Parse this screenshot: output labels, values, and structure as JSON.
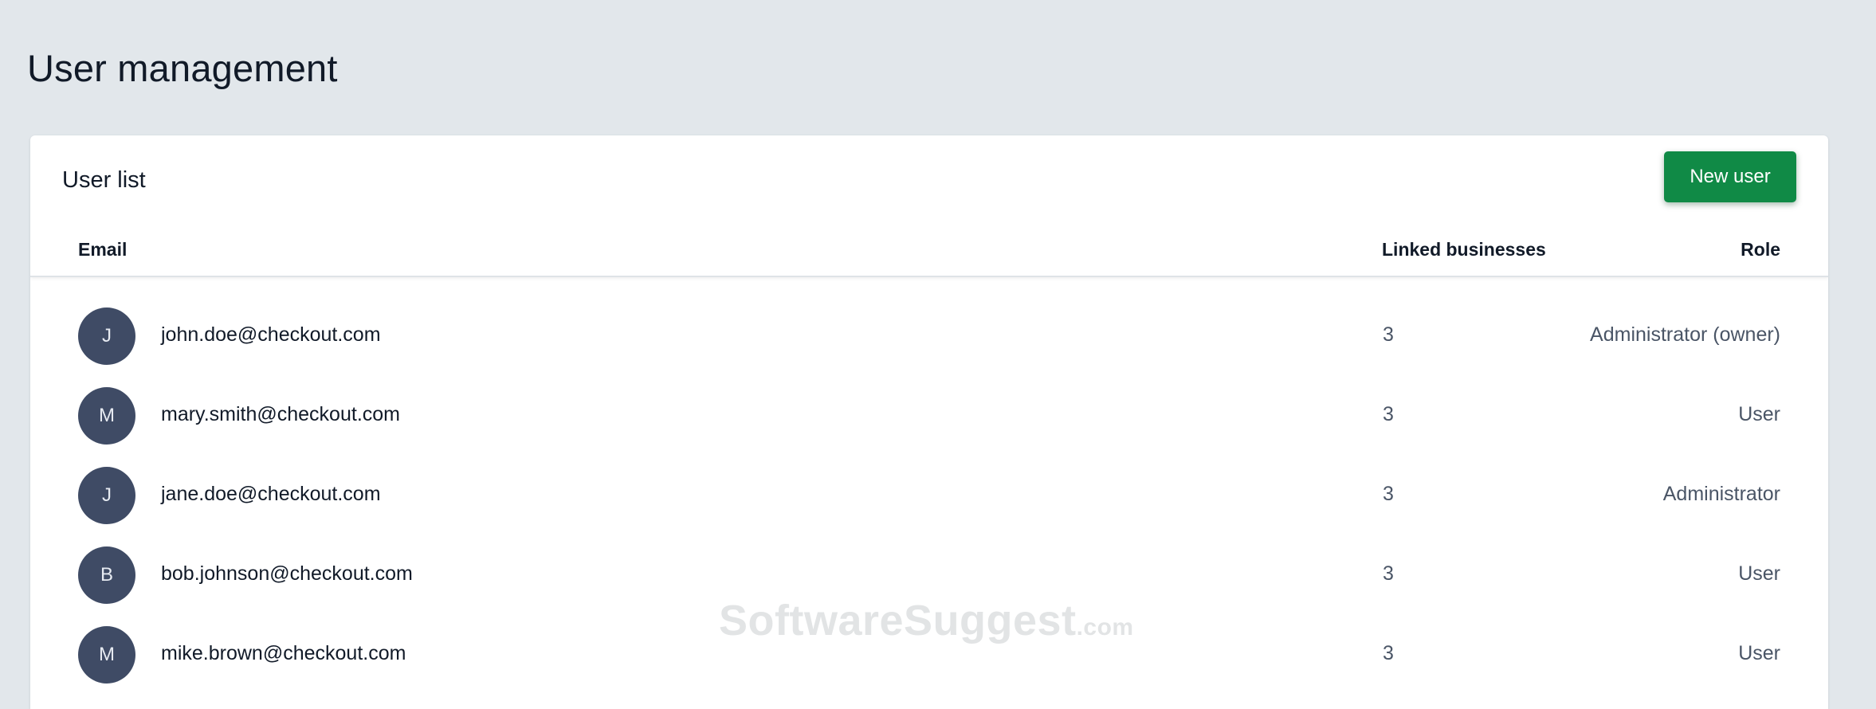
{
  "page": {
    "title": "User management"
  },
  "card": {
    "title": "User list",
    "new_user_label": "New user"
  },
  "table": {
    "headers": {
      "email": "Email",
      "linked": "Linked businesses",
      "role": "Role"
    },
    "rows": [
      {
        "initial": "J",
        "email": "john.doe@checkout.com",
        "linked": "3",
        "role": "Administrator (owner)"
      },
      {
        "initial": "M",
        "email": "mary.smith@checkout.com",
        "linked": "3",
        "role": "User"
      },
      {
        "initial": "J",
        "email": "jane.doe@checkout.com",
        "linked": "3",
        "role": "Administrator"
      },
      {
        "initial": "B",
        "email": "bob.johnson@checkout.com",
        "linked": "3",
        "role": "User"
      },
      {
        "initial": "M",
        "email": "mike.brown@checkout.com",
        "linked": "3",
        "role": "User"
      }
    ]
  },
  "watermark": {
    "main": "SoftwareSuggest",
    "suffix": ".com"
  },
  "colors": {
    "background": "#e2e7eb",
    "primary_button": "#108a46",
    "avatar": "#3f4b65"
  }
}
